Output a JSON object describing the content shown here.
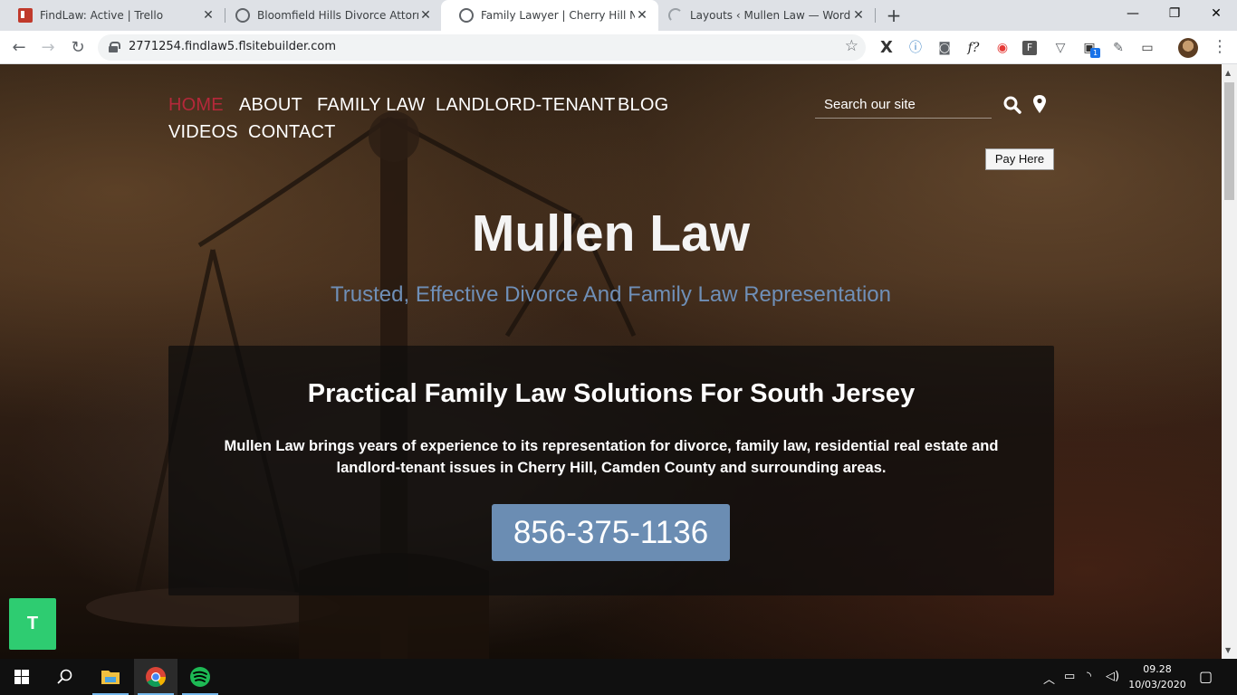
{
  "browser": {
    "tabs": [
      {
        "title": "FindLaw: Active | Trello",
        "close": "✕"
      },
      {
        "title": "Bloomfield Hills Divorce Attorney",
        "close": "✕"
      },
      {
        "title": "Family Lawyer | Cherry Hill New J",
        "close": "✕"
      },
      {
        "title": "Layouts ‹ Mullen Law — WordPre",
        "close": "✕"
      }
    ],
    "new_tab": "+",
    "url": "2771254.findlaw5.flsitebuilder.com",
    "window_controls": {
      "minimize": "—",
      "maximize": "❐",
      "close": "✕"
    },
    "extension_badge": "1"
  },
  "site": {
    "nav": {
      "items": [
        "HOME",
        "ABOUT",
        "FAMILY LAW",
        "LANDLORD-TENANT",
        "BLOG",
        "VIDEOS",
        "CONTACT"
      ],
      "active": "HOME"
    },
    "search": {
      "placeholder": "Search our site"
    },
    "pay_button": "Pay Here",
    "hero": {
      "title": "Mullen Law",
      "subtitle": "Trusted, Effective Divorce And Family Law Representation"
    },
    "box": {
      "heading": "Practical Family Law Solutions For South Jersey",
      "text": "Mullen Law brings years of experience to its representation for divorce, family law, residential real estate and landlord-tenant issues in Cherry Hill, Camden County and surrounding areas.",
      "phone": "856-375-1136"
    },
    "chat_button": "T"
  },
  "taskbar": {
    "time": "09.28",
    "date": "10/03/2020"
  },
  "colors": {
    "nav_active": "#b5283a",
    "subtitle": "#6f8fb7",
    "phone_button": "#6b8db3",
    "chat_button": "#2ecc71"
  }
}
